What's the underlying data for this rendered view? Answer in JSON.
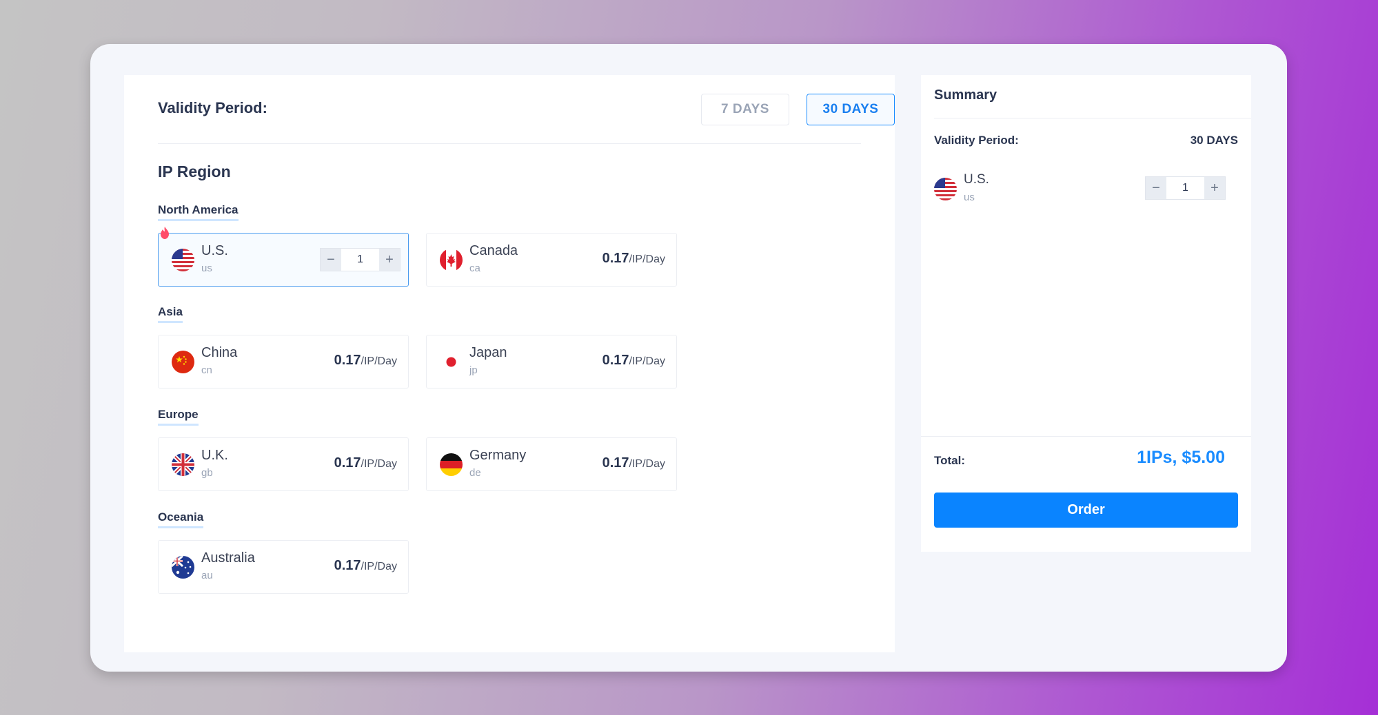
{
  "validity": {
    "label": "Validity Period:",
    "options": [
      "7 DAYS",
      "30 DAYS"
    ],
    "selected": "30 DAYS"
  },
  "ip_region": {
    "title": "IP Region",
    "groups": [
      {
        "name": "North America",
        "items": [
          {
            "country": "U.S.",
            "code": "us",
            "flag": "us-flag-icon",
            "selected": true,
            "quantity": "1"
          },
          {
            "country": "Canada",
            "code": "ca",
            "flag": "canada-flag-icon",
            "price": "0.17",
            "unit": "/IP/Day"
          }
        ]
      },
      {
        "name": "Asia",
        "items": [
          {
            "country": "China",
            "code": "cn",
            "flag": "china-flag-icon",
            "price": "0.17",
            "unit": "/IP/Day"
          },
          {
            "country": "Japan",
            "code": "jp",
            "flag": "japan-flag-icon",
            "price": "0.17",
            "unit": "/IP/Day"
          }
        ]
      },
      {
        "name": "Europe",
        "items": [
          {
            "country": "U.K.",
            "code": "gb",
            "flag": "uk-flag-icon",
            "price": "0.17",
            "unit": "/IP/Day"
          },
          {
            "country": "Germany",
            "code": "de",
            "flag": "germany-flag-icon",
            "price": "0.17",
            "unit": "/IP/Day"
          }
        ]
      },
      {
        "name": "Oceania",
        "items": [
          {
            "country": "Australia",
            "code": "au",
            "flag": "australia-flag-icon",
            "price": "0.17",
            "unit": "/IP/Day"
          }
        ]
      }
    ]
  },
  "stepper": {
    "minus": "−",
    "plus": "+"
  },
  "summary": {
    "title": "Summary",
    "validity_label": "Validity Period:",
    "validity_value": "30 DAYS",
    "item": {
      "country": "U.S.",
      "code": "us",
      "quantity": "1"
    },
    "total_label": "Total:",
    "total_value": "1IPs, $5.00",
    "order_label": "Order"
  },
  "colors": {
    "accent": "#0a84ff",
    "text": "#2a3550",
    "muted": "#9aa4b6"
  }
}
